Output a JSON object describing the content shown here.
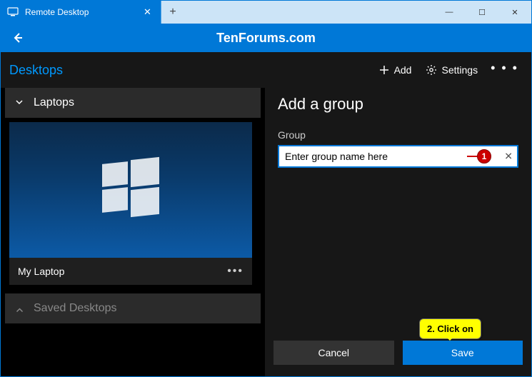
{
  "titlebar": {
    "tab_label": "Remote Desktop",
    "new_tab": "+",
    "minimize": "—",
    "maximize": "☐",
    "close": "✕",
    "tab_close": "✕"
  },
  "watermark": "TenForums.com",
  "left": {
    "title": "Desktops",
    "groups": [
      {
        "name": "Laptops",
        "expanded": true
      },
      {
        "name": "Saved Desktops",
        "expanded": false
      }
    ],
    "pc": {
      "name": "My Laptop",
      "more": "•••"
    }
  },
  "top_actions": {
    "add": "Add",
    "settings": "Settings",
    "more": "• • •"
  },
  "form": {
    "title": "Add a group",
    "label": "Group",
    "input_value": "Enter group name here",
    "clear": "✕"
  },
  "buttons": {
    "cancel": "Cancel",
    "save": "Save"
  },
  "callouts": {
    "step1": "1",
    "step2": "2. Click on"
  }
}
